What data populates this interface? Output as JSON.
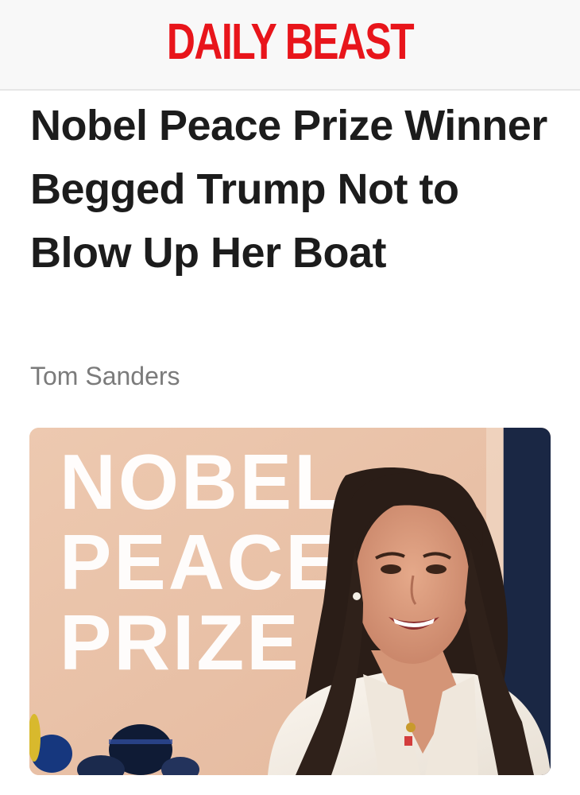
{
  "header": {
    "logo_text": "DAILY BEAST",
    "logo_color": "#e8151b"
  },
  "article": {
    "headline": "Nobel Peace Prize Winner Begged Trump Not to Blow Up Her Boat",
    "author": "Tom Sanders"
  },
  "hero_image": {
    "backdrop_lines": [
      "NOBEL",
      "PEACE",
      "PRIZE"
    ]
  },
  "colors": {
    "headline": "#1c1c1c",
    "byline": "#7b7b7b",
    "header_bg": "#f8f8f8"
  }
}
